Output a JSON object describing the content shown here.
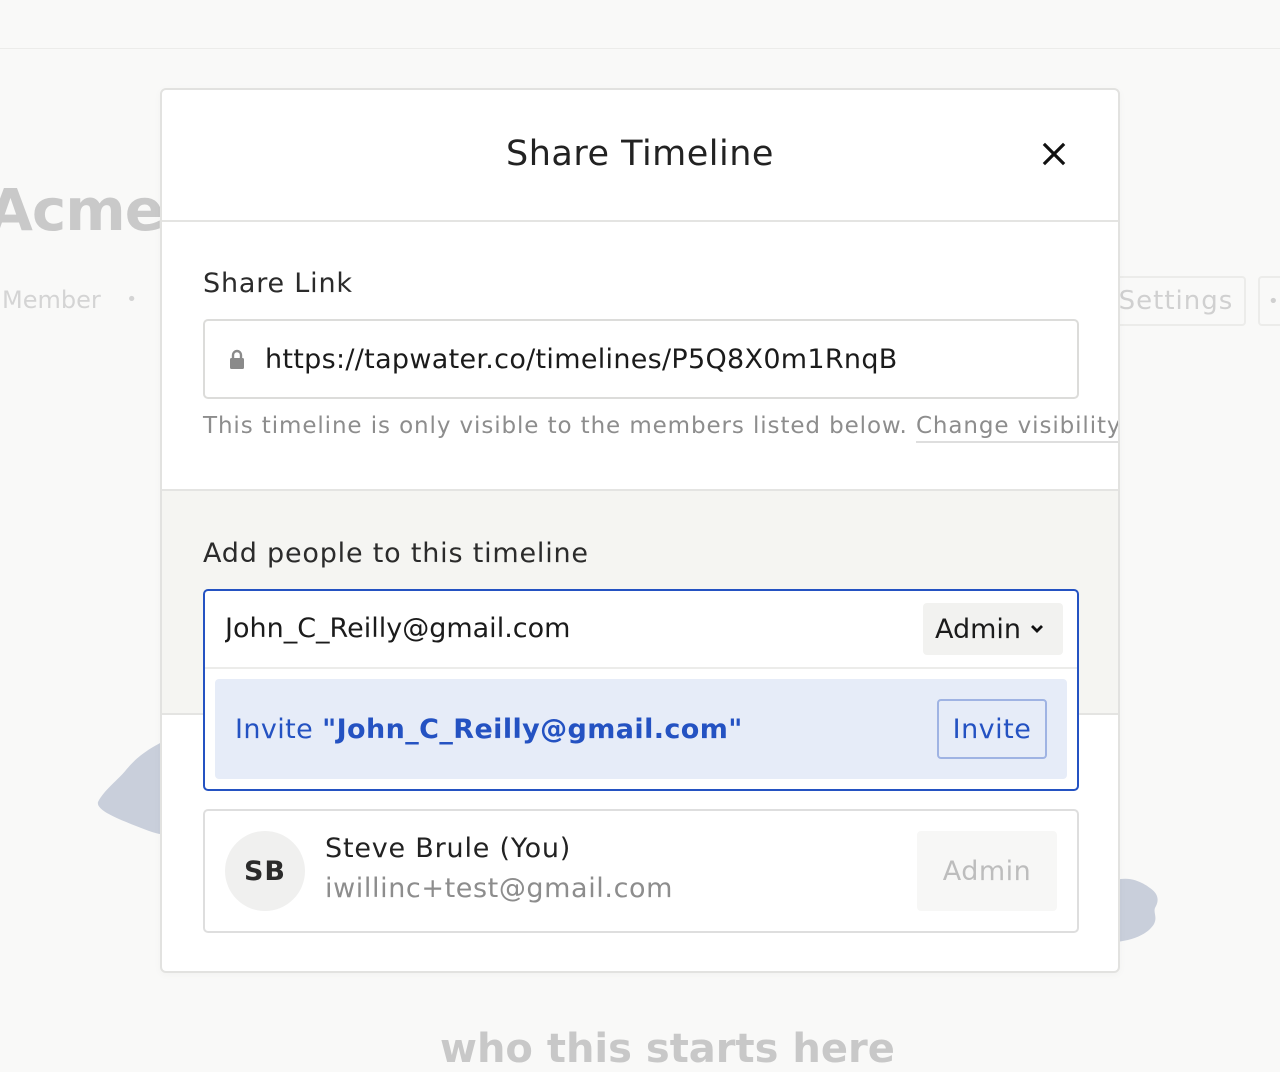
{
  "background": {
    "page_title": "Acme I",
    "meta_label": "Member",
    "meta_dots": "•",
    "settings_label": "Settings",
    "more_label": "•",
    "bottom_text": "who this starts here"
  },
  "modal": {
    "title": "Share Timeline",
    "close_icon": "close-icon",
    "share_link": {
      "label": "Share Link",
      "icon": "lock-icon",
      "url": "https://tapwater.co/timelines/P5Q8X0m1RnqB",
      "visibility_note": "This timeline is only visible to the members listed below.",
      "change_visibility_label": "Change visibility"
    },
    "add_people": {
      "label": "Add people to this timeline",
      "input_value": "John_C_Reilly@gmail.com",
      "role": "Admin",
      "role_icon": "chevron-down-icon",
      "suggestion_prefix": "Invite ",
      "suggestion_email": "\"John_C_Reilly@gmail.com\"",
      "invite_button": "Invite"
    },
    "members": [
      {
        "initials": "SB",
        "name": "Steve Brule (You)",
        "email": "iwillinc+test@gmail.com",
        "role": "Admin"
      }
    ]
  },
  "colors": {
    "accent": "#2452c2",
    "suggestion_bg": "#e6ecf8",
    "section_bg": "#f5f5f2"
  }
}
